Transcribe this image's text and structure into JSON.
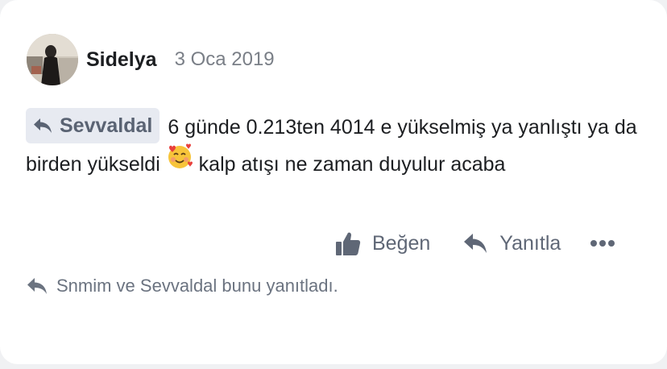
{
  "post": {
    "username": "Sidelya",
    "date": "3 Oca 2019",
    "mention": "Sevvaldal",
    "text_part1": "6 günde 0.213ten 4014 e yükselmiş ya yanlıştı ya da birden yükseldi",
    "emoji": "smiling-face-with-hearts",
    "text_part2": "kalp atışı ne zaman duyulur acaba"
  },
  "actions": {
    "like_label": "Beğen",
    "reply_label": "Yanıtla",
    "more_label": "•••"
  },
  "replies": {
    "summary": "Snmim ve Sevvaldal bunu yanıtladı."
  },
  "colors": {
    "accent_gray": "#5f6776",
    "mention_bg": "#e7eaf1",
    "text": "#1c1e21"
  }
}
